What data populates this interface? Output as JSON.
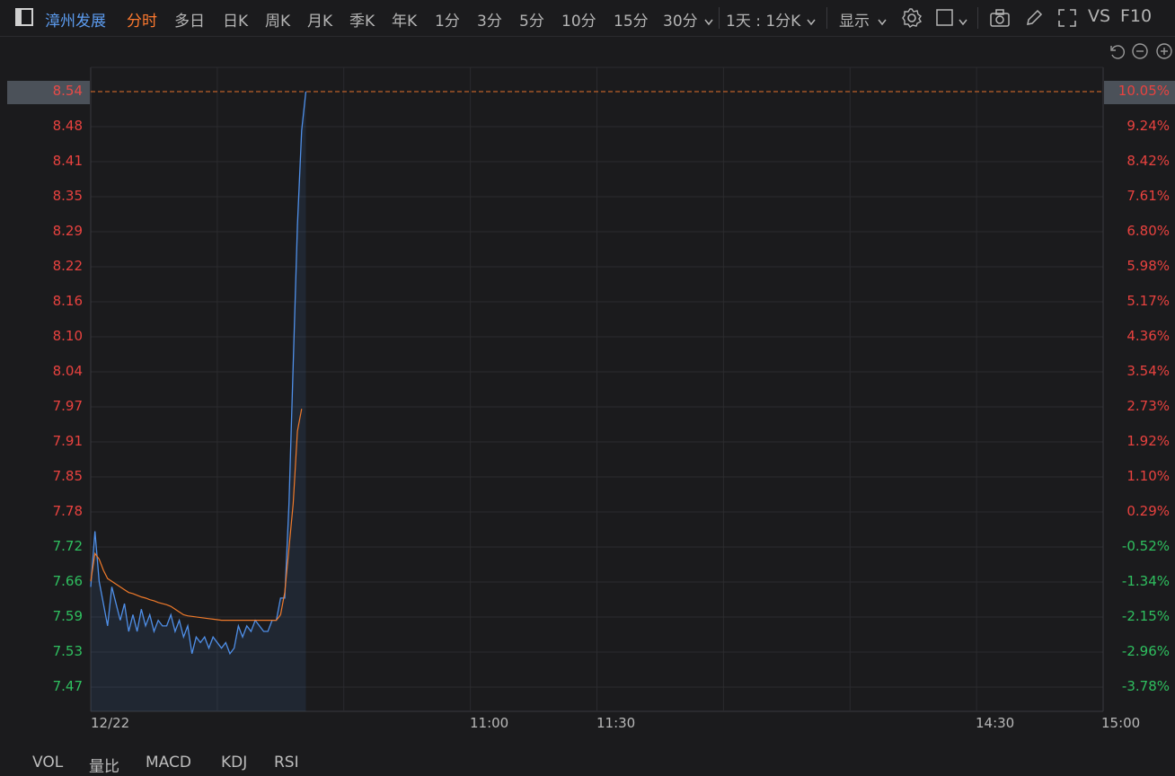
{
  "toolbar": {
    "stock_name": "漳州发展",
    "periods": [
      "分时",
      "多日",
      "日K",
      "周K",
      "月K",
      "季K",
      "年K",
      "1分",
      "3分",
      "5分",
      "10分",
      "15分",
      "30分"
    ],
    "active_period": "分时",
    "range_select": "1天 : 1分K",
    "display_select": "显示",
    "vs_label": "VS",
    "f10_label": "F10"
  },
  "chart": {
    "date_label": "12/22",
    "x_ticks": [
      "11:00",
      "11:30",
      "14:30",
      "15:00"
    ],
    "price_labels": [
      "8.54",
      "8.48",
      "8.41",
      "8.35",
      "8.29",
      "8.22",
      "8.16",
      "8.10",
      "8.04",
      "7.97",
      "7.91",
      "7.85",
      "7.78",
      "7.72",
      "7.66",
      "7.59",
      "7.53",
      "7.47"
    ],
    "pct_labels": [
      "10.05%",
      "9.24%",
      "8.42%",
      "7.61%",
      "6.80%",
      "5.98%",
      "5.17%",
      "4.36%",
      "3.54%",
      "2.73%",
      "1.92%",
      "1.10%",
      "0.29%",
      "-0.52%",
      "-1.34%",
      "-2.15%",
      "-2.96%",
      "-3.78%"
    ],
    "label_up_color": "#e8423f",
    "label_down_color": "#2fbf5f",
    "limit_line_color": "#e5702b",
    "price_line_color": "#4f8fe8",
    "avg_line_color": "#f07a2a"
  },
  "chart_data": {
    "type": "line",
    "xlabel": "",
    "ylabel": "",
    "ylim": [
      7.44,
      8.56
    ],
    "x": [
      0,
      1,
      2,
      3,
      4,
      5,
      6,
      7,
      8,
      9,
      10,
      11,
      12,
      13,
      14,
      15,
      16,
      17,
      18,
      19,
      20,
      21,
      22,
      23,
      24,
      25,
      26,
      27,
      28,
      29,
      30,
      31,
      32,
      33,
      34,
      35,
      36,
      37,
      38,
      39,
      40,
      41,
      42,
      43,
      44,
      45,
      46,
      47,
      48,
      49,
      50,
      51,
      52,
      53,
      54,
      55
    ],
    "series": [
      {
        "values": [
          7.65,
          7.75,
          7.66,
          7.62,
          7.58,
          7.65,
          7.62,
          7.59,
          7.62,
          7.57,
          7.6,
          7.57,
          7.61,
          7.58,
          7.6,
          7.57,
          7.59,
          7.58,
          7.58,
          7.6,
          7.57,
          7.59,
          7.56,
          7.58,
          7.53,
          7.56,
          7.55,
          7.56,
          7.54,
          7.56,
          7.55,
          7.54,
          7.55,
          7.53,
          7.54,
          7.58,
          7.56,
          7.58,
          7.57,
          7.59,
          7.58,
          7.57,
          7.57,
          7.59,
          7.59,
          7.63,
          7.63,
          7.8,
          8.05,
          8.3,
          8.47,
          8.54
        ]
      },
      {
        "values": [
          7.66,
          7.71,
          7.7,
          7.68,
          7.665,
          7.66,
          7.655,
          7.65,
          7.645,
          7.64,
          7.638,
          7.635,
          7.632,
          7.63,
          7.627,
          7.625,
          7.622,
          7.62,
          7.618,
          7.615,
          7.61,
          7.605,
          7.6,
          7.598,
          7.597,
          7.596,
          7.595,
          7.594,
          7.593,
          7.592,
          7.591,
          7.59,
          7.59,
          7.59,
          7.59,
          7.59,
          7.59,
          7.59,
          7.59,
          7.59,
          7.59,
          7.59,
          7.59,
          7.59,
          7.59,
          7.6,
          7.64,
          7.72,
          7.8,
          7.93,
          7.97
        ]
      }
    ]
  },
  "bottom_tabs": [
    "VOL",
    "量比",
    "MACD",
    "KDJ",
    "RSI"
  ]
}
